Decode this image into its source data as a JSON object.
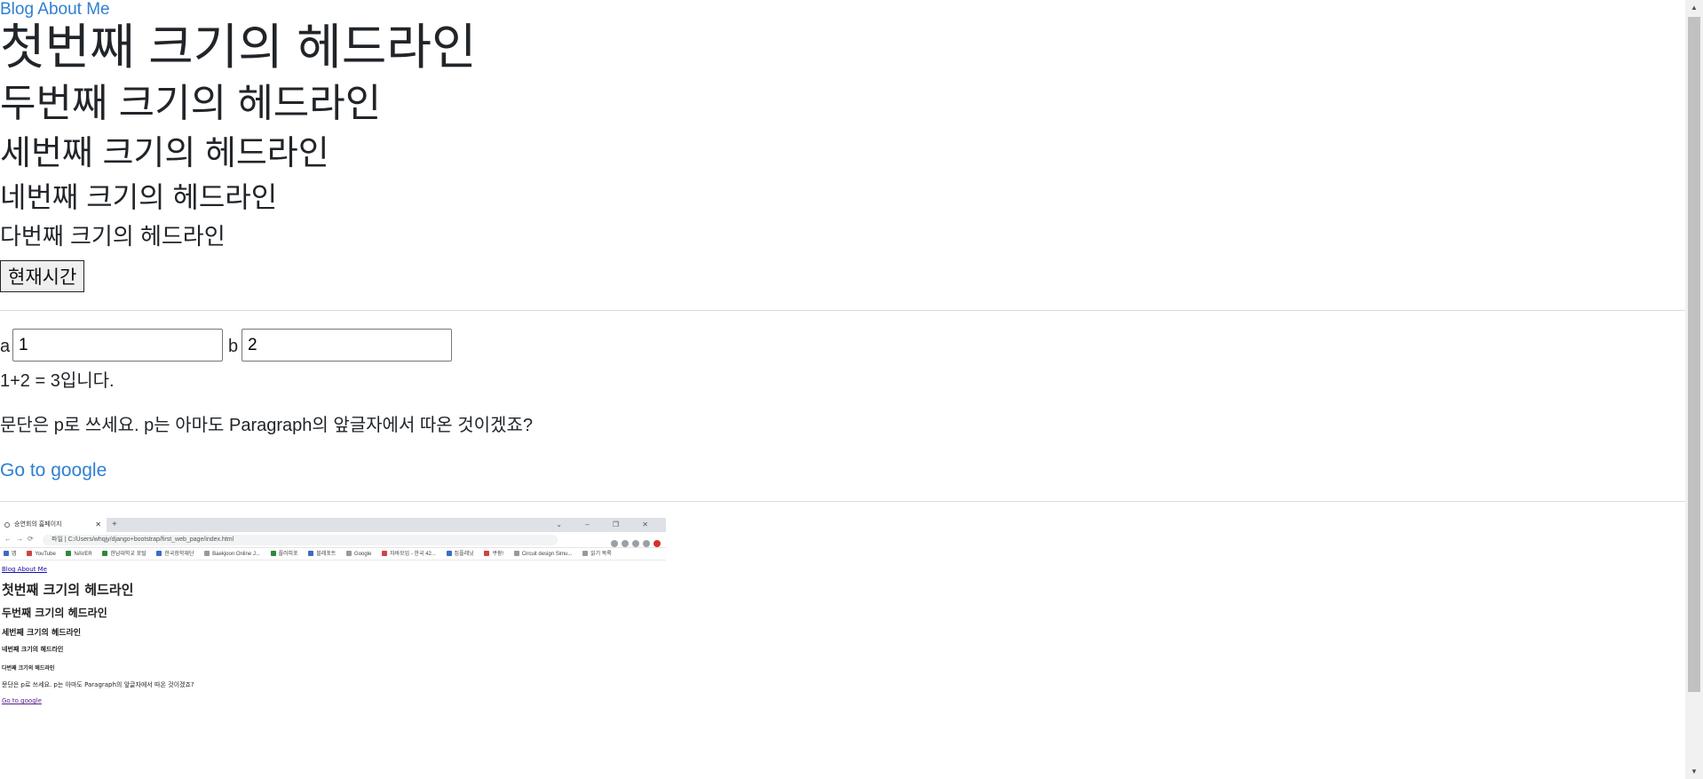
{
  "nav": {
    "blog": "Blog",
    "about": "About Me"
  },
  "headings": {
    "h1": "첫번째 크기의 헤드라인",
    "h2": "두번째 크기의 헤드라인",
    "h3": "세번째 크기의 헤드라인",
    "h4": "네번째 크기의 헤드라인",
    "h5": "다번째 크기의 헤드라인"
  },
  "time_button": "현재시간",
  "calc": {
    "a_label": "a",
    "a_value": "1",
    "b_label": "b",
    "b_value": "2",
    "result": "1+2 = 3입니다."
  },
  "paragraph": "문단은 p로 쓰세요. p는 아마도 Paragraph의 앞글자에서 따온 것이겠죠?",
  "google_link": "Go to google",
  "embedded_screenshot": {
    "tab_title": "승연회의 홈페이지",
    "address": "C:/Users/whqjy/django+bootstrap/first_web_page/index.html",
    "address_prefix": "파일",
    "bookmarks": [
      "앱",
      "YouTube",
      "NAVER",
      "한남대학교 포털",
      "한국장학재단",
      "Baekjoon Online J...",
      "플러피포",
      "블레포트",
      "Google",
      "자바모임 - 한국 42...",
      "집플레닛",
      "쿠팡!",
      "Circuit design Simu...",
      "읽기 목록"
    ],
    "nav": "Blog About Me",
    "h1": "첫번째 크기의 헤드라인",
    "h2": "두번째 크기의 헤드라인",
    "h3": "세번째 크기의 헤드라인",
    "h4": "네번째 크기의 헤드라인",
    "h5": "다번째 크기의 헤드라인",
    "paragraph": "문단은 p로 쓰세요. p는 아마도 Paragraph의 앞글자에서 따온 것이겠죠?",
    "link": "Go to google"
  }
}
